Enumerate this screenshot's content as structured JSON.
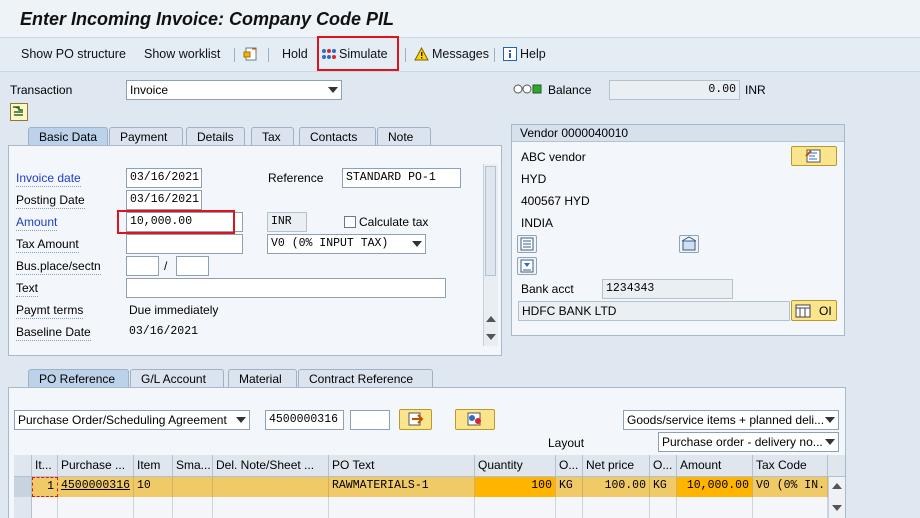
{
  "title": "Enter Incoming Invoice: Company Code PIL",
  "toolbar": {
    "show_po_structure": "Show PO structure",
    "show_worklist": "Show worklist",
    "hold": "Hold",
    "simulate": "Simulate",
    "messages": "Messages",
    "help": "Help"
  },
  "transaction": {
    "label": "Transaction",
    "value": "Invoice"
  },
  "balance": {
    "label": "Balance",
    "value": "0.00",
    "currency": "INR"
  },
  "header_tabs": [
    "Basic Data",
    "Payment",
    "Details",
    "Tax",
    "Contacts",
    "Note"
  ],
  "basic": {
    "invoice_date_label": "Invoice date",
    "invoice_date": "03/16/2021",
    "posting_date_label": "Posting Date",
    "posting_date": "03/16/2021",
    "reference_label": "Reference",
    "reference": "STANDARD PO-1",
    "amount_label": "Amount",
    "amount": "10,000.00",
    "currency": "INR",
    "calculate_tax_label": "Calculate tax",
    "tax_amount_label": "Tax Amount",
    "tax_code": "V0 (0% INPUT TAX)",
    "bus_place_label": "Bus.place/sectn",
    "slash": "/",
    "text_label": "Text",
    "paymt_terms_label": "Paymt terms",
    "paymt_terms": "Due immediately",
    "baseline_date_label": "Baseline Date",
    "baseline_date": "03/16/2021"
  },
  "vendor": {
    "header": "Vendor 0000040010",
    "name": "ABC vendor",
    "city": "HYD",
    "postal": "400567 HYD",
    "country": "INDIA",
    "bank_acct_label": "Bank acct",
    "bank_acct": "1234343",
    "bank_name": "HDFC BANK LTD",
    "oi_label": "OI"
  },
  "po_tabs": [
    "PO Reference",
    "G/L Account",
    "Material",
    "Contract Reference"
  ],
  "po_ref": {
    "doc_type": "Purchase Order/Scheduling Agreement",
    "po_number": "4500000316",
    "item_filter": "Goods/service items + planned deli...",
    "layout_label": "Layout",
    "layout": "Purchase order - delivery no..."
  },
  "table": {
    "columns": [
      "It...",
      "Purchase ...",
      "Item",
      "Sma...",
      "Del. Note/Sheet ...",
      "PO Text",
      "Quantity",
      "O...",
      "Net price",
      "O...",
      "Amount",
      "Tax Code"
    ],
    "row": {
      "item": "1",
      "po": "4500000316",
      "po_item": "10",
      "sma": "",
      "del_note": "",
      "po_text": "RAWMATERIALS-1",
      "quantity": "100",
      "unit": "KG",
      "net_price": "100.00",
      "price_unit": "KG",
      "amount": "10,000.00",
      "tax_code": "V0 (0% IN..."
    }
  },
  "colors": {
    "highlight": "#e0121a",
    "row": "#f1ca68",
    "editable_cell": "#ffb400"
  }
}
